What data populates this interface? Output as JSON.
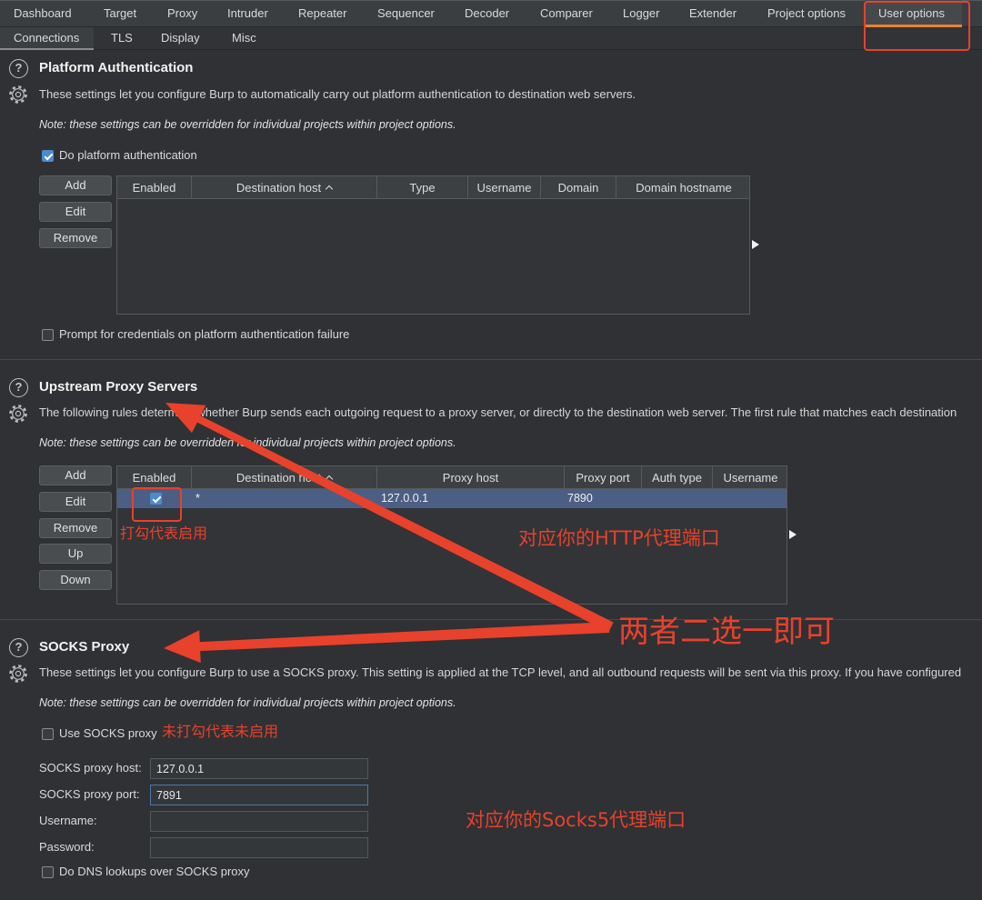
{
  "tabs": {
    "main": [
      "Dashboard",
      "Target",
      "Proxy",
      "Intruder",
      "Repeater",
      "Sequencer",
      "Decoder",
      "Comparer",
      "Logger",
      "Extender",
      "Project options",
      "User options"
    ],
    "main_selected": "User options",
    "sub": [
      "Connections",
      "TLS",
      "Display",
      "Misc"
    ],
    "sub_selected": "Connections"
  },
  "platform_auth": {
    "title": "Platform Authentication",
    "description": "These settings let you configure Burp to automatically carry out platform authentication to destination web servers.",
    "note": "Note: these settings can be overridden for individual projects within project options.",
    "enable_label": "Do platform authentication",
    "enable_checked": true,
    "buttons": {
      "add": "Add",
      "edit": "Edit",
      "remove": "Remove"
    },
    "columns": [
      "Enabled",
      "Destination host",
      "Type",
      "Username",
      "Domain",
      "Domain hostname"
    ],
    "sorted_column": "Destination host",
    "sort_direction": "ascending",
    "rows": [],
    "prompt_label": "Prompt for credentials on platform authentication failure",
    "prompt_checked": false
  },
  "upstream_proxy": {
    "title": "Upstream Proxy Servers",
    "description": "The following rules determine whether Burp sends each outgoing request to a proxy server, or directly to the destination web server. The first rule that matches each destination",
    "note": "Note: these settings can be overridden for individual projects within project options.",
    "buttons": {
      "add": "Add",
      "edit": "Edit",
      "remove": "Remove",
      "up": "Up",
      "down": "Down"
    },
    "columns": [
      "Enabled",
      "Destination host",
      "Proxy host",
      "Proxy port",
      "Auth type",
      "Username"
    ],
    "sorted_column": "Destination host",
    "sort_direction": "ascending",
    "rows": [
      {
        "enabled": true,
        "destination_host": "*",
        "proxy_host": "127.0.0.1",
        "proxy_port": "7890"
      }
    ],
    "selected_row": 0
  },
  "socks_proxy": {
    "title": "SOCKS Proxy",
    "description": "These settings let you configure Burp to use a SOCKS proxy. This setting is applied at the TCP level, and all outbound requests will be sent via this proxy. If you have configured",
    "note": "Note: these settings can be overridden for individual projects within project options.",
    "use_label": "Use SOCKS proxy",
    "use_checked": false,
    "host_label": "SOCKS proxy host:",
    "host_value": "127.0.0.1",
    "port_label": "SOCKS proxy port:",
    "port_value": "7891",
    "username_label": "Username:",
    "password_label": "Password:",
    "dns_label": "Do DNS lookups over SOCKS proxy",
    "dns_checked": false
  },
  "annotations": {
    "checkbox_note": "打勾代表启用",
    "http_port_note": "对应你的HTTP代理端口",
    "choose_one_note": "两者二选一即可",
    "socks_unchecked_note": "未打勾代表未启用",
    "socks_port_note": "对应你的Socks5代理端口"
  },
  "icons": {
    "help": "help-icon",
    "settings": "gear-icon",
    "sort": "sort-ascending-icon",
    "expand": "expand-right-icon",
    "check": "checkmark-icon"
  },
  "colors": {
    "annotation_red": "#e8412c",
    "checkbox_blue": "#4b8bd0",
    "selected_row": "#4b5f84",
    "tab_underline": "#e8812f",
    "background": "#2f3134"
  }
}
